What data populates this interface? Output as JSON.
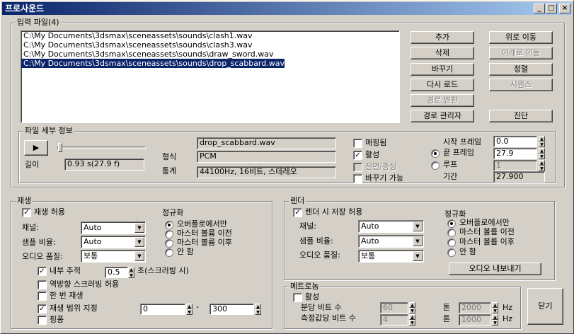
{
  "window": {
    "title": "프로사운드",
    "min": "_",
    "max": "□",
    "close": "×"
  },
  "input": {
    "group_label": "입력 파일(4)",
    "files": [
      "C:\\My Documents\\3dsmax\\sceneassets\\sounds\\clash1.wav",
      "C:\\My Documents\\3dsmax\\sceneassets\\sounds\\clash3.wav",
      "C:\\My Documents\\3dsmax\\sceneassets\\sounds\\draw_sword.wav",
      "C:\\My Documents\\3dsmax\\sceneassets\\sounds\\drop_scabbard.wav"
    ],
    "selected_index": 3,
    "buttons": {
      "add": "추가",
      "move_up": "위로 이동",
      "delete": "삭제",
      "move_down": "아래로 이동",
      "replace": "바꾸기",
      "sort": "정렬",
      "reload": "다시 로드",
      "sequence": "시퀀스",
      "convert_path": "경로 변환",
      "path_manager": "경로 관리자",
      "diagnose": "진단"
    }
  },
  "file_details": {
    "group_label": "파일 세부 정보",
    "play_icon": "play-icon",
    "length_label": "길이",
    "length_value": "0.93 s(27.9 f)",
    "filename": "drop_scabbard.wav",
    "format_label": "형식",
    "format_value": "PCM",
    "stats_label": "통계",
    "stats_value": "44100Hz, 16비트, 스테레오",
    "mapping_label": "매핑됨",
    "active_label": "활성",
    "front_center_label": "전면/중심",
    "replaceable_label": "바꾸기 가능",
    "start_frame_label": "시작 프레임",
    "start_frame_value": "0.0",
    "end_frame_label": "끝 프레임",
    "end_frame_value": "27.9",
    "loop_label": "루프",
    "loop_value": "1",
    "duration_label": "기간",
    "duration_value": "27.900"
  },
  "playback": {
    "group_label": "재생",
    "enable_label": "재생 허용",
    "channel_label": "채널:",
    "channel_value": "Auto",
    "sample_rate_label": "샘플 비율:",
    "sample_rate_value": "Auto",
    "quality_label": "오디오 품질:",
    "quality_value": "보통",
    "normalize_label": "정규화",
    "norm_options": [
      "오버플로에서만",
      "마스터 볼륨 이전",
      "마스터 볼륨 이후",
      "안 함"
    ],
    "internal_track_label": "내부 추적",
    "internal_track_value": "0.5",
    "scrub_suffix": "초(스크러빙 시)",
    "reverse_scrub_label": "역방향 스크러빙 허용",
    "play_once_label": "한 번 재생",
    "range_label": "재생 범위 지정",
    "range_start": "0",
    "range_dash": "-",
    "range_end": "300",
    "pingpong_label": "핑퐁"
  },
  "render": {
    "group_label": "렌더",
    "save_label": "렌더 시 저장 허용",
    "channel_label": "채널:",
    "channel_value": "Auto",
    "sample_rate_label": "샘플 비율:",
    "sample_rate_value": "Auto",
    "quality_label": "오디오 품질:",
    "quality_value": "보통",
    "normalize_label": "정규화",
    "norm_options": [
      "오버플로에서만",
      "마스터 볼륨 이전",
      "마스터 볼륨 이후",
      "안 함"
    ],
    "export_button": "오디오 내보내기"
  },
  "metronome": {
    "group_label": "메트로놈",
    "active_label": "활성",
    "beats_per_min_label": "분당 비트 수",
    "beats_per_min_value": "60",
    "beats_per_measure_label": "측정값당 비트 수",
    "beats_per_measure_value": "4",
    "tone1_label": "톤",
    "tone1_value": "2000",
    "tone2_label": "톤",
    "tone2_value": "1000",
    "hz1": "Hz",
    "hz2": "Hz"
  },
  "close_button": "닫기"
}
